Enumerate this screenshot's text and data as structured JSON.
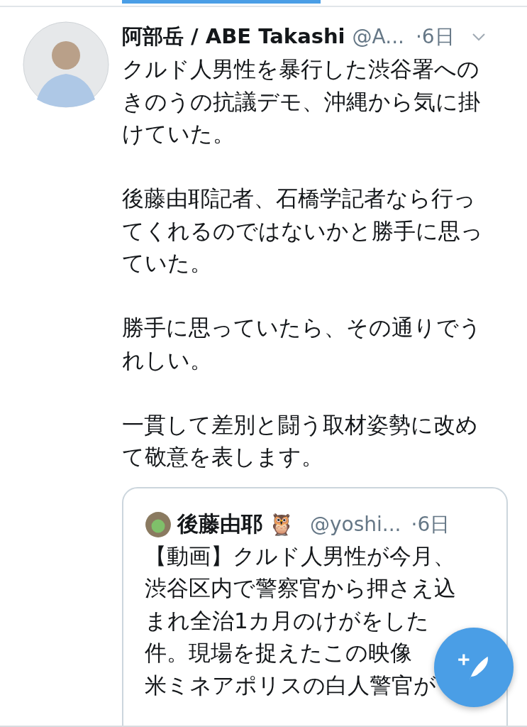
{
  "tweet": {
    "display_name": "阿部岳 / ABE Takashi",
    "handle": "@A...",
    "time": "·6日",
    "paragraphs": [
      "クルド人男性を暴行した渋谷署へのきのうの抗議デモ、沖縄から気に掛けていた。",
      "後藤由耶記者、石橋学記者なら行ってくれるのではないかと勝手に思っていた。",
      "勝手に思っていたら、その通りでうれしい。",
      "一貫して差別と闘う取材姿勢に改めて敬意を表します。"
    ]
  },
  "quoted_tweet": {
    "display_name": "後藤由耶",
    "emoji": "🦉",
    "handle": "@yoshi...",
    "time": "·6日",
    "lines": [
      "【動画】クルド人男性が今月、",
      "渋谷区内で警察官から押さえ込",
      "まれ全治1カ月のけがをした",
      "件。現場を捉えたこの映像",
      "米ミネアポリスの白人警官が"
    ]
  }
}
